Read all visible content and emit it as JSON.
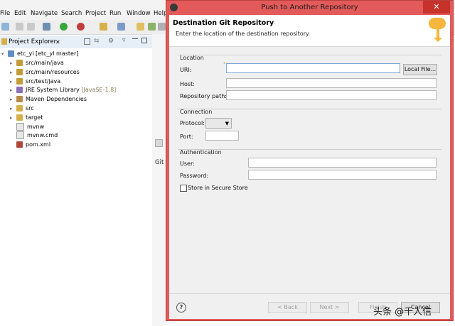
{
  "menu": [
    "File",
    "Edit",
    "Navigate",
    "Search",
    "Project",
    "Run",
    "Window",
    "Help"
  ],
  "project_explorer": {
    "title": "Project Explorer",
    "root": "etc_yl  [etc_yl master]",
    "items": [
      {
        "label": "src/main/java",
        "arrow": "▸",
        "extra": ""
      },
      {
        "label": "src/main/resources",
        "arrow": "▸",
        "extra": ""
      },
      {
        "label": "src/test/java",
        "arrow": "▸",
        "extra": ""
      },
      {
        "label": "JRE System Library ",
        "arrow": "▸",
        "extra": "[JavaSE-1.8]"
      },
      {
        "label": "Maven Dependencies",
        "arrow": "▸",
        "extra": ""
      },
      {
        "label": "src",
        "arrow": "▸",
        "extra": ""
      },
      {
        "label": "target",
        "arrow": "▸",
        "extra": ""
      },
      {
        "label": "mvnw",
        "arrow": "",
        "extra": ""
      },
      {
        "label": "mvnw.cmd",
        "arrow": "",
        "extra": ""
      },
      {
        "label": "pom.xml",
        "arrow": "",
        "extra": ""
      }
    ]
  },
  "background": {
    "git_label": "Git"
  },
  "dialog": {
    "title": "Push to Another Repository",
    "close": "✕",
    "heading": "Destination Git Repository",
    "description": "Enter the location of the destination repository.",
    "location_group": "Location",
    "uri_label": "URI:",
    "uri_value": "",
    "local_file_button": "Local File...",
    "host_label": "Host:",
    "host_value": "",
    "repo_path_label": "Repository path:",
    "repo_path_value": "",
    "connection_group": "Connection",
    "protocol_label": "Protocol:",
    "protocol_value": "",
    "port_label": "Port:",
    "port_value": "",
    "auth_group": "Authentication",
    "user_label": "User:",
    "user_value": "",
    "password_label": "Password:",
    "password_value": "",
    "store_label": "Store in Secure Store",
    "help": "?",
    "back_button": "< Back",
    "next_button": "Next >",
    "finish_button": "Finish",
    "cancel_button": "Cancel"
  },
  "watermark": "头条 @千人信",
  "colors": {
    "dialog_border": "#e35a5a",
    "close_button": "#c7322b",
    "banner_icon": "#f6b73c"
  }
}
